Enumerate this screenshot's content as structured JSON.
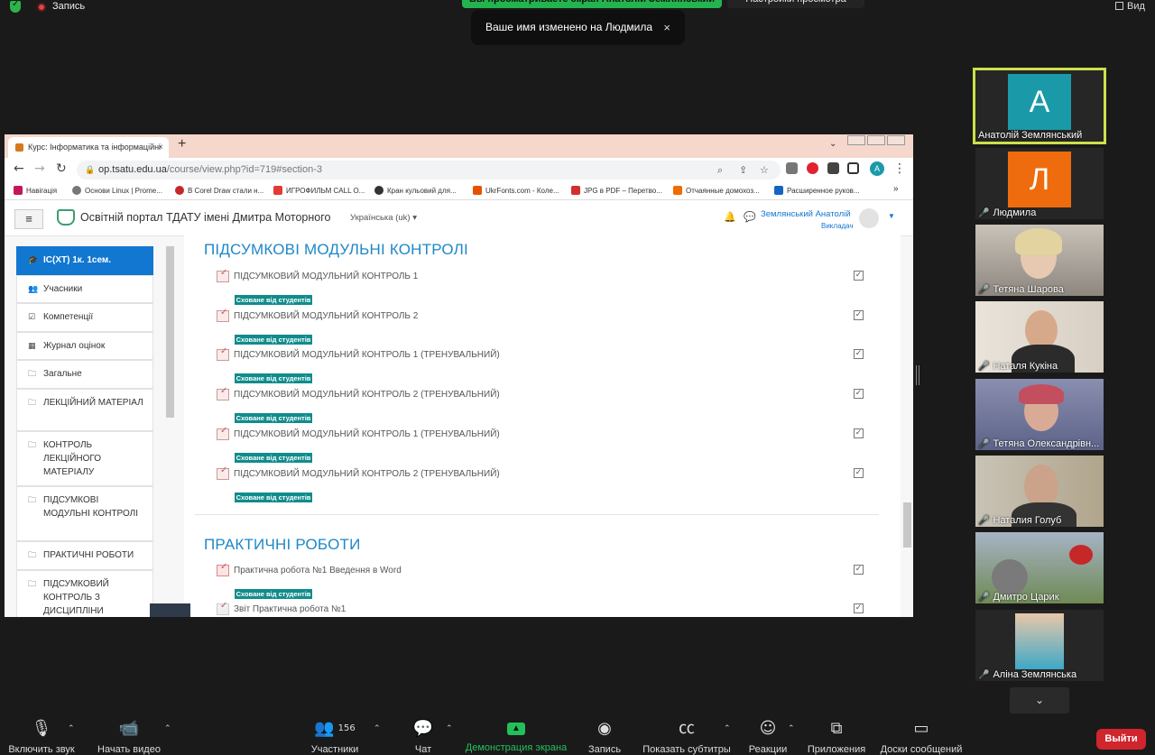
{
  "zoom": {
    "recording_label": "Запись",
    "share_banner": "Вы просматриваете экран Анатолій Землянський",
    "view_settings": "Настройки просмотра",
    "view_button": "Вид",
    "toast_message": "Ваше имя изменено на Людмила",
    "toast_close": "×"
  },
  "browser": {
    "tab_title": "Курс: Інформатика та інформаційні",
    "tab_close": "×",
    "new_tab": "+",
    "url_host": "op.tsatu.edu.ua",
    "url_path": "/course/view.php?id=719#section-3",
    "profile_letter": "A",
    "bookmarks": [
      "Навігація",
      "Основи Linux | Prome...",
      "В Corel Draw стали н...",
      "ИГРОФИЛЬМ CALL O...",
      "Кран кульовий для...",
      "UkrFonts.com - Коле...",
      "JPG в PDF – Перетво...",
      "Отчаянные домохоз...",
      "Расширенное руков..."
    ],
    "bookmarks_more": "»"
  },
  "moodle": {
    "menu_icon": "≡",
    "site_title": "Освітній портал ТДАТУ імені Дмитра Моторного",
    "language": "Українська (uk) ▾",
    "user_name": "Землянський Анатолій",
    "user_role": "Викладач",
    "sidebar": [
      {
        "icon": "graduation-cap-icon",
        "glyph": "🎓",
        "label": "ІС(ХТ) 1к. 1сем."
      },
      {
        "icon": "users-icon",
        "glyph": "👥",
        "label": "Учасники"
      },
      {
        "icon": "checkbox-icon",
        "glyph": "☑",
        "label": "Компетенції"
      },
      {
        "icon": "table-icon",
        "glyph": "▦",
        "label": "Журнал оцінок"
      },
      {
        "icon": "folder-icon",
        "glyph": "🗀",
        "label": "Загальне"
      },
      {
        "icon": "folder-icon",
        "glyph": "🗀",
        "label": "ЛЕКЦІЙНИЙ МАТЕРІАЛ"
      },
      {
        "icon": "folder-icon",
        "glyph": "🗀",
        "label": "КОНТРОЛЬ ЛЕКЦІЙНОГО МАТЕРІАЛУ"
      },
      {
        "icon": "folder-icon",
        "glyph": "🗀",
        "label": "ПІДСУМКОВІ МОДУЛЬНІ КОНТРОЛІ"
      },
      {
        "icon": "folder-icon",
        "glyph": "🗀",
        "label": "ПРАКТИЧНІ РОБОТИ"
      },
      {
        "icon": "folder-icon",
        "glyph": "🗀",
        "label": "ПІДСУМКОВИЙ КОНТРОЛЬ З ДИСЦИПЛІНИ"
      }
    ],
    "hidden_badge": "Сховане від студентів",
    "sections": [
      {
        "title": "ПІДСУМКОВІ МОДУЛЬНІ КОНТРОЛІ",
        "activities": [
          "ПІДСУМКОВИЙ МОДУЛЬНИЙ КОНТРОЛЬ 1",
          "ПІДСУМКОВИЙ МОДУЛЬНИЙ КОНТРОЛЬ 2",
          "ПІДСУМКОВИЙ МОДУЛЬНИЙ КОНТРОЛЬ 1 (ТРЕНУВАЛЬНИЙ)",
          "ПІДСУМКОВИЙ МОДУЛЬНИЙ КОНТРОЛЬ 2 (ТРЕНУВАЛЬНИЙ)",
          "ПІДСУМКОВИЙ МОДУЛЬНИЙ КОНТРОЛЬ 1 (ТРЕНУВАЛЬНИЙ)",
          "ПІДСУМКОВИЙ МОДУЛЬНИЙ КОНТРОЛЬ 2 (ТРЕНУВАЛЬНИЙ)"
        ]
      },
      {
        "title": "ПРАКТИЧНІ РОБОТИ",
        "activities": [
          "Практична робота №1 Введення в Word",
          "Звіт Практична робота №1"
        ]
      }
    ]
  },
  "participants": [
    {
      "name": "Анатолій Землянський",
      "initial": "A",
      "color": "#1a9aa8",
      "muted": false,
      "active": true
    },
    {
      "name": "Людмила",
      "initial": "Л",
      "color": "#ee6c0d",
      "muted": true,
      "active": false
    },
    {
      "name": "Тетяна Шарова",
      "muted": true
    },
    {
      "name": "Наталя Кукіна",
      "muted": true
    },
    {
      "name": "Тетяна Олександрівн...",
      "muted": true
    },
    {
      "name": "Наталия Голуб",
      "muted": true
    },
    {
      "name": "Дмитро Царик",
      "muted": true
    },
    {
      "name": "Аліна Землянська",
      "muted": true
    }
  ],
  "controls": {
    "unmute": "Включить звук",
    "start_video": "Начать видео",
    "participants": "Участники",
    "participants_count": "156",
    "chat": "Чат",
    "share_screen": "Демонстрация экрана",
    "record": "Запись",
    "captions": "Показать субтитры",
    "reactions": "Реакции",
    "apps": "Приложения",
    "whiteboards": "Доски сообщений",
    "leave": "Выйти"
  }
}
